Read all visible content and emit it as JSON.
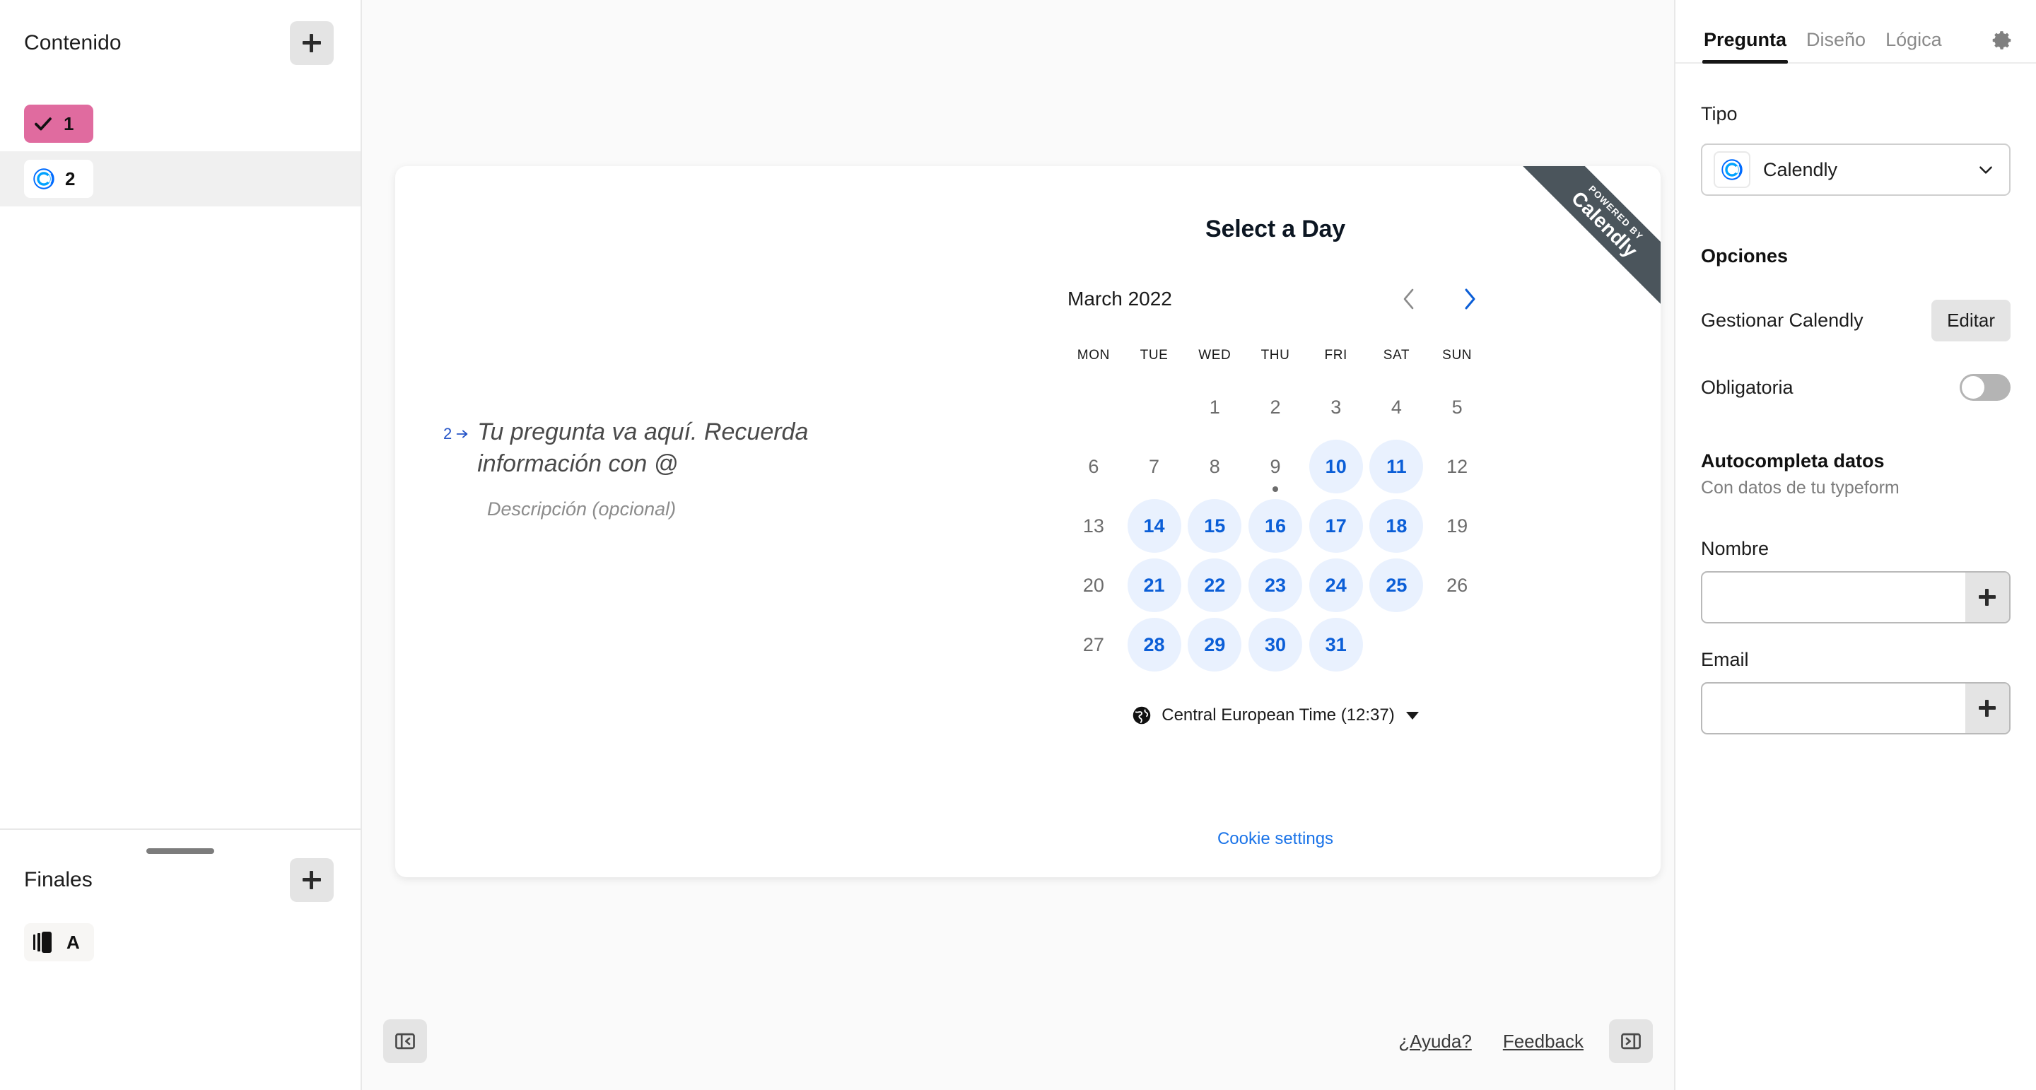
{
  "sidebar": {
    "title": "Contenido",
    "add_button_label": "+",
    "items": [
      {
        "number": "1",
        "icon": "check-icon",
        "selected": false
      },
      {
        "number": "2",
        "icon": "calendly-icon",
        "selected": true
      }
    ],
    "endings": {
      "title": "Finales",
      "add_button_label": "+",
      "items": [
        {
          "letter": "A",
          "icon": "ending-card-icon"
        }
      ]
    }
  },
  "card": {
    "ribbon": {
      "line1": "POWERED BY",
      "line2": "Calendly"
    },
    "question": {
      "index": "2",
      "text": "Tu pregunta va aquí. Recuerda información con @",
      "description": "Descripción (opcional)"
    },
    "calendly": {
      "title": "Select a Day",
      "month": "March 2022",
      "prev_label": "‹",
      "next_label": "›",
      "dow": [
        "MON",
        "TUE",
        "WED",
        "THU",
        "FRI",
        "SAT",
        "SUN"
      ],
      "leading_blanks": 2,
      "days": [
        {
          "n": "1",
          "available": false,
          "today": false
        },
        {
          "n": "2",
          "available": false,
          "today": false
        },
        {
          "n": "3",
          "available": false,
          "today": false
        },
        {
          "n": "4",
          "available": false,
          "today": false
        },
        {
          "n": "5",
          "available": false,
          "today": false
        },
        {
          "n": "6",
          "available": false,
          "today": false
        },
        {
          "n": "7",
          "available": false,
          "today": false
        },
        {
          "n": "8",
          "available": false,
          "today": false
        },
        {
          "n": "9",
          "available": false,
          "today": true
        },
        {
          "n": "10",
          "available": true,
          "today": false
        },
        {
          "n": "11",
          "available": true,
          "today": false
        },
        {
          "n": "12",
          "available": false,
          "today": false
        },
        {
          "n": "13",
          "available": false,
          "today": false
        },
        {
          "n": "14",
          "available": true,
          "today": false
        },
        {
          "n": "15",
          "available": true,
          "today": false
        },
        {
          "n": "16",
          "available": true,
          "today": false
        },
        {
          "n": "17",
          "available": true,
          "today": false
        },
        {
          "n": "18",
          "available": true,
          "today": false
        },
        {
          "n": "19",
          "available": false,
          "today": false
        },
        {
          "n": "20",
          "available": false,
          "today": false
        },
        {
          "n": "21",
          "available": true,
          "today": false
        },
        {
          "n": "22",
          "available": true,
          "today": false
        },
        {
          "n": "23",
          "available": true,
          "today": false
        },
        {
          "n": "24",
          "available": true,
          "today": false
        },
        {
          "n": "25",
          "available": true,
          "today": false
        },
        {
          "n": "26",
          "available": false,
          "today": false
        },
        {
          "n": "27",
          "available": false,
          "today": false
        },
        {
          "n": "28",
          "available": true,
          "today": false
        },
        {
          "n": "29",
          "available": true,
          "today": false
        },
        {
          "n": "30",
          "available": true,
          "today": false
        },
        {
          "n": "31",
          "available": true,
          "today": false
        }
      ],
      "timezone": "Central European Time (12:37)",
      "cookie_settings": "Cookie settings"
    }
  },
  "bottom_bar": {
    "help_label": "¿Ayuda?",
    "feedback_label": "Feedback"
  },
  "right_panel": {
    "tabs": [
      {
        "label": "Pregunta",
        "active": true
      },
      {
        "label": "Diseño",
        "active": false
      },
      {
        "label": "Lógica",
        "active": false
      }
    ],
    "type_label": "Tipo",
    "type_value": "Calendly",
    "options_label": "Opciones",
    "manage_label": "Gestionar Calendly",
    "edit_button": "Editar",
    "required_label": "Obligatoria",
    "required_on": false,
    "autofill_title": "Autocompleta datos",
    "autofill_sub": "Con datos de tu typeform",
    "name_label": "Nombre",
    "name_value": "",
    "email_label": "Email",
    "email_value": ""
  },
  "colors": {
    "accent_blue": "#0b5ed7",
    "link_blue": "#1a73e8",
    "pink_chip": "#e06b9f",
    "ribbon_gray": "#4b555c"
  }
}
